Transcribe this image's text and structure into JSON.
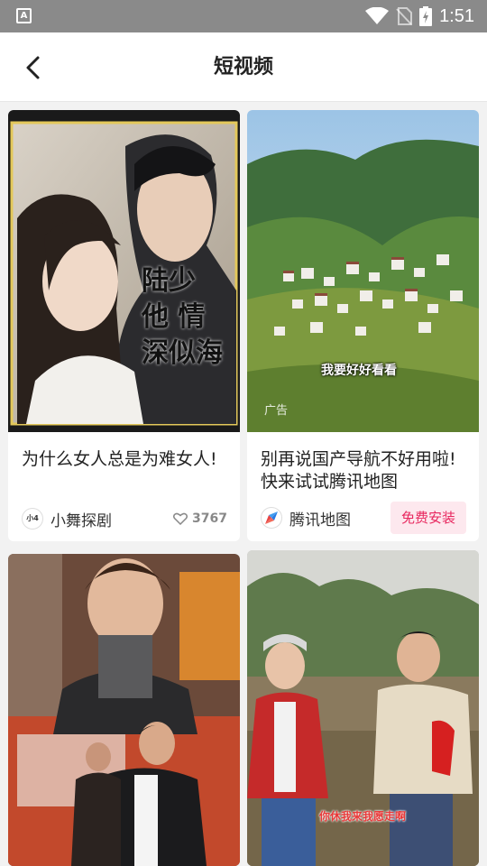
{
  "status": {
    "time": "1:51",
    "app_badge": "A"
  },
  "header": {
    "title": "短视频"
  },
  "cards": [
    {
      "title": "为什么女人总是为难女人!",
      "author": "小舞探剧",
      "avatar_text": "小4",
      "likes": "3767",
      "thumb_text": "陆少 他 情深似海"
    },
    {
      "title": "别再说国产导航不好用啦!快来试试腾讯地图",
      "author": "腾讯地图",
      "ad_label": "广告",
      "install_label": "免费安装",
      "thumb_caption": "我要好好看看"
    },
    {
      "title": "",
      "author": ""
    },
    {
      "title": "",
      "author": "",
      "thumb_caption": "你休我来我愿走啊"
    }
  ],
  "colors": {
    "status_bar": "#8a8a8a",
    "accent_pink": "#e8285f",
    "install_bg": "#fde8ee"
  }
}
